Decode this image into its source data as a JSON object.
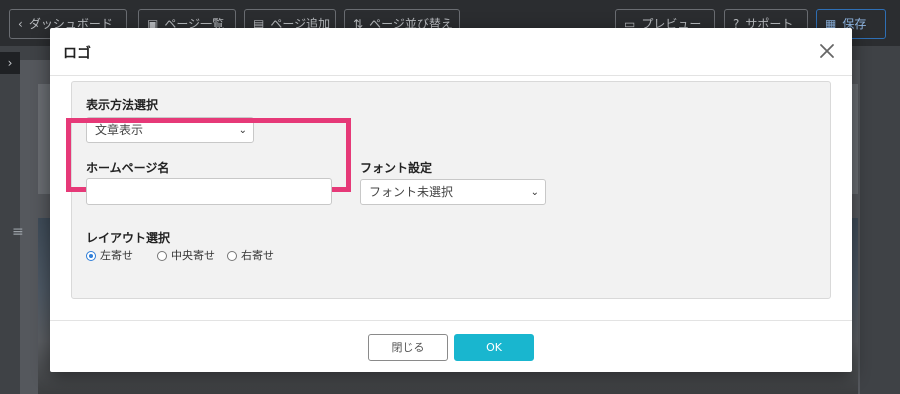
{
  "toolbar": {
    "dashboard_label": "ダッシュボード",
    "page_list_label": "ページ一覧",
    "add_page_label": "ページ追加",
    "sort_pages_label": "ページ並び替え",
    "preview_label": "プレビュー",
    "support_label": "サポート",
    "save_label": "保存"
  },
  "dialog": {
    "title": "ロゴ",
    "display_method": {
      "label": "表示方法選択",
      "selected": "文章表示"
    },
    "homepage_name": {
      "label": "ホームページ名",
      "value": "",
      "highlight_color": "#e63978"
    },
    "font": {
      "label": "フォント設定",
      "selected": "フォント未選択"
    },
    "layout": {
      "label": "レイアウト選択",
      "options": [
        {
          "label": "左寄せ",
          "checked": true
        },
        {
          "label": "中央寄せ",
          "checked": false
        },
        {
          "label": "右寄せ",
          "checked": false
        }
      ]
    },
    "buttons": {
      "close_label": "閉じる",
      "ok_label": "OK",
      "ok_color": "#19b6cf"
    }
  }
}
